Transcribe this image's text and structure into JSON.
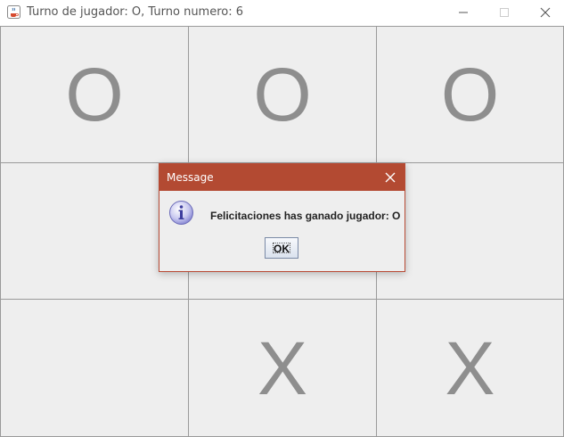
{
  "window": {
    "title": "Turno de jugador: O, Turno numero: 6"
  },
  "board": {
    "cells": [
      "O",
      "O",
      "O",
      "",
      "",
      "",
      "",
      "X",
      "X"
    ]
  },
  "dialog": {
    "title": "Message",
    "message": "Felicitaciones has ganado jugador: O",
    "ok_label": "OK"
  },
  "colors": {
    "dialog_titlebar": "#b34a32",
    "board_background": "#eeeeee",
    "mark": "#8e8e8e"
  },
  "icons": {
    "app": "java-coffee-icon",
    "info": "info-icon",
    "minimize": "minimize-icon",
    "maximize": "maximize-icon",
    "close": "close-icon"
  }
}
